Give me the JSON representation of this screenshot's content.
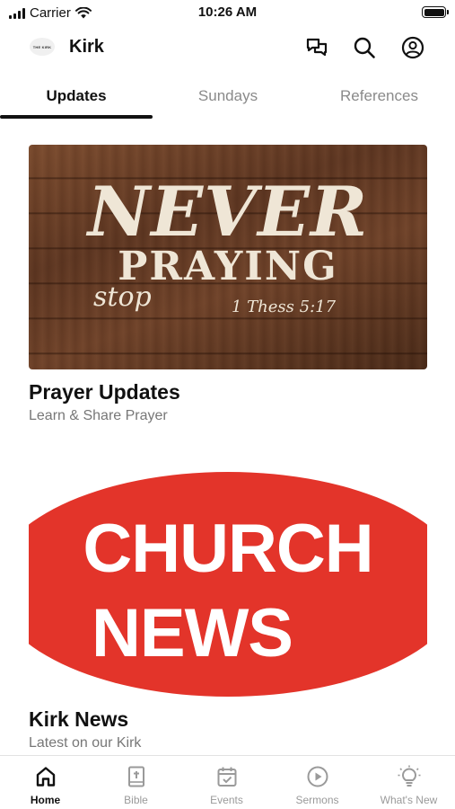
{
  "status_bar": {
    "carrier": "Carrier",
    "time": "10:26 AM"
  },
  "header": {
    "logo_text": "THE KIRK",
    "title": "Kirk"
  },
  "tabs": [
    {
      "label": "Updates",
      "active": true
    },
    {
      "label": "Sundays",
      "active": false
    },
    {
      "label": "References",
      "active": false
    }
  ],
  "cards": [
    {
      "title": "Prayer Updates",
      "subtitle": "Learn & Share Prayer",
      "image": {
        "line1": "NEVER",
        "line2": "stop",
        "line3": "PRAYING",
        "line4": "1 Thess 5:17"
      }
    },
    {
      "title": "Kirk News",
      "subtitle": "Latest on our Kirk",
      "image": {
        "line1": "CHURCH",
        "line2": "NEWS"
      }
    }
  ],
  "bottom_nav": [
    {
      "label": "Home",
      "icon": "home-icon",
      "active": true
    },
    {
      "label": "Bible",
      "icon": "bible-icon",
      "active": false
    },
    {
      "label": "Events",
      "icon": "calendar-icon",
      "active": false
    },
    {
      "label": "Sermons",
      "icon": "play-icon",
      "active": false
    },
    {
      "label": "What's New",
      "icon": "lightbulb-icon",
      "active": false
    }
  ],
  "colors": {
    "accent": "#111111",
    "inactive": "#8a8a8a",
    "news_red": "#e3342a",
    "wood": "#5e3621"
  }
}
